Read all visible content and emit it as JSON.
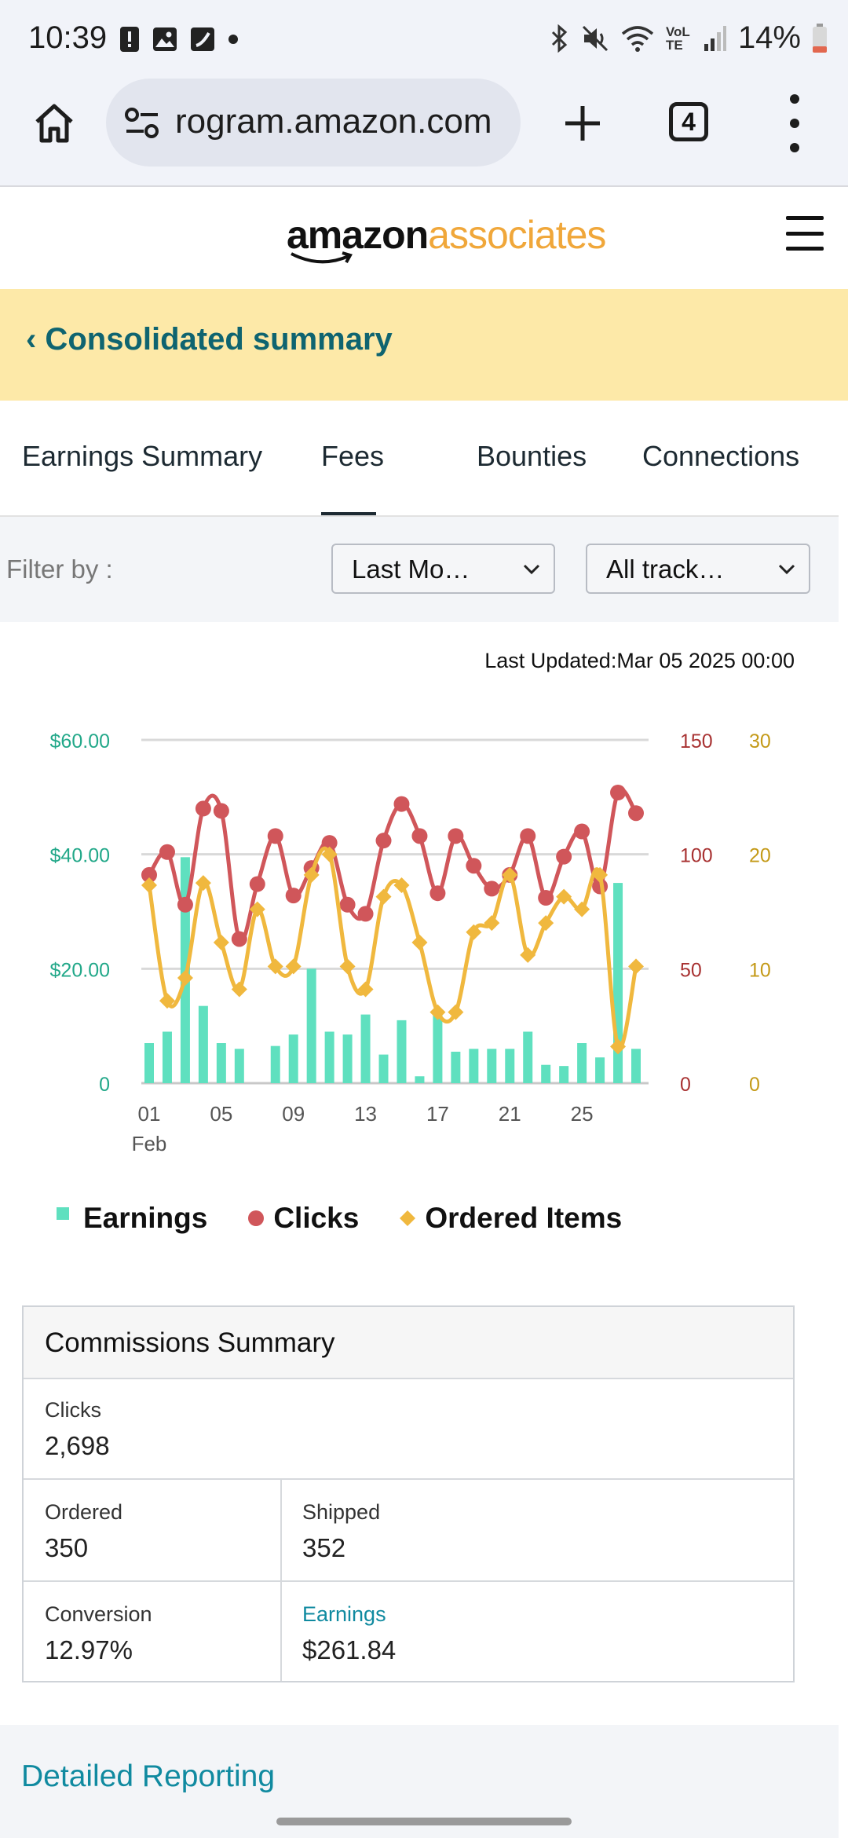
{
  "status_bar": {
    "time": "10:39",
    "battery": "14%",
    "network": "VoLTE",
    "left_icons": [
      "alert-icon",
      "image-icon",
      "app-icon",
      "dot-icon"
    ],
    "right_icons": [
      "bluetooth-icon",
      "mute-icon",
      "wifi-icon",
      "signal-icon",
      "battery-icon"
    ]
  },
  "browser": {
    "url": "rogram.amazon.com",
    "tab_count": "4"
  },
  "site": {
    "logo_amazon": "amazon",
    "logo_associates": "associates",
    "back_link": "‹ Consolidated summary"
  },
  "tabs": [
    {
      "label": "Earnings Summary",
      "active": false
    },
    {
      "label": "Fees",
      "active": true
    },
    {
      "label": "Bounties",
      "active": false
    },
    {
      "label": "Connections",
      "active": false
    }
  ],
  "filter": {
    "label": "Filter by :",
    "period_value": "Last Mo…",
    "tracking_value": "All track…"
  },
  "last_updated": "Last Updated:Mar 05 2025 00:00",
  "chart_data": {
    "type": "bar+line",
    "x": [
      1,
      2,
      3,
      4,
      5,
      6,
      7,
      8,
      9,
      10,
      11,
      12,
      13,
      14,
      15,
      16,
      17,
      18,
      19,
      20,
      21,
      22,
      23,
      24,
      25,
      26,
      27,
      28
    ],
    "x_tick_labels": [
      "01",
      "05",
      "09",
      "13",
      "17",
      "21",
      "25"
    ],
    "x_tick_values": [
      1,
      5,
      9,
      13,
      17,
      21,
      25
    ],
    "x_sublabel": "Feb",
    "y_left": {
      "ticks": [
        "$60.00",
        "$40.00",
        "$20.00",
        "0"
      ],
      "range": [
        0,
        60
      ],
      "color": "#22a889"
    },
    "y_right1": {
      "ticks": [
        "150",
        "100",
        "50",
        "0"
      ],
      "range": [
        0,
        150
      ],
      "color": "#a83232"
    },
    "y_right2": {
      "ticks": [
        "30",
        "20",
        "10",
        "0"
      ],
      "range": [
        0,
        30
      ],
      "color": "#c49a18"
    },
    "grid": true,
    "legend_position": "bottom",
    "series": [
      {
        "name": "Earnings",
        "type": "bar",
        "axis": "left",
        "color": "#5fe0bf",
        "values": [
          7,
          9,
          39.5,
          13.5,
          7,
          6,
          0,
          6.5,
          8.5,
          20,
          9,
          8.5,
          12,
          5,
          11,
          1.2,
          12.5,
          5.5,
          6,
          6,
          6,
          9,
          3.2,
          3,
          7,
          4.5,
          35,
          6
        ]
      },
      {
        "name": "Clicks",
        "type": "line",
        "axis": "right1",
        "color": "#d0565a",
        "values": [
          91,
          101,
          78,
          120,
          119,
          63,
          87,
          108,
          82,
          94,
          105,
          78,
          74,
          106,
          122,
          108,
          83,
          108,
          95,
          85,
          91,
          108,
          81,
          99,
          110,
          86,
          127,
          118
        ]
      },
      {
        "name": "Ordered Items",
        "type": "line",
        "axis": "right2",
        "color": "#f0b83e",
        "values": [
          17.3,
          7.2,
          9.2,
          17.5,
          12.3,
          8.2,
          15.2,
          10.2,
          10.2,
          18.2,
          20.0,
          10.2,
          8.2,
          16.3,
          17.3,
          12.3,
          6.2,
          6.2,
          13.2,
          14.0,
          18.2,
          11.2,
          14.0,
          16.3,
          15.2,
          18.2,
          3.2,
          10.2
        ]
      }
    ]
  },
  "summary": {
    "title": "Commissions Summary",
    "clicks_label": "Clicks",
    "clicks_value": "2,698",
    "ordered_label": "Ordered",
    "ordered_value": "350",
    "shipped_label": "Shipped",
    "shipped_value": "352",
    "conversion_label": "Conversion",
    "conversion_value": "12.97%",
    "earnings_label": "Earnings",
    "earnings_value": "$261.84"
  },
  "detailed_reporting": "Detailed Reporting",
  "colors": {
    "banner_bg": "#fde9a8",
    "link_teal": "#108aa0",
    "banner_link": "#0f6470",
    "brand_orange": "#f0a73a"
  }
}
